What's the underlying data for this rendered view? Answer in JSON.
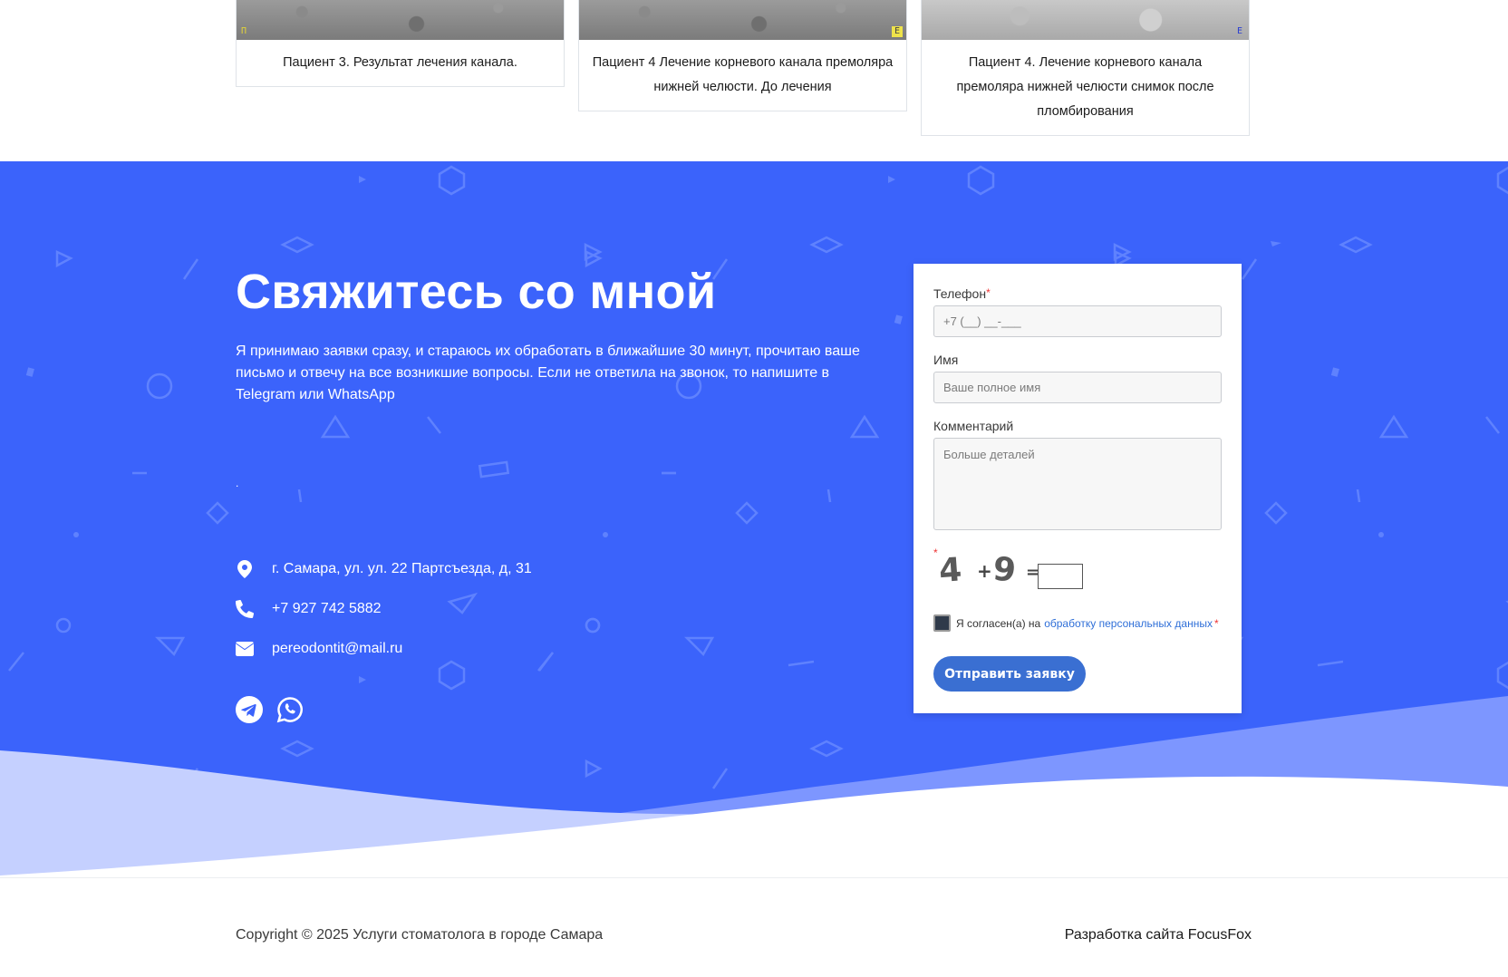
{
  "gallery": {
    "cards": [
      {
        "caption": "Пациент 3. Результат лечения канала."
      },
      {
        "caption": "Пациент 4 Лечение корневого канала премоляра нижней челюсти. До лечения"
      },
      {
        "caption": "Пациент 4. Лечение корневого канала премоляра нижней челюсти снимок после пломбирования"
      }
    ]
  },
  "contact": {
    "title": "Свяжитесь со мной",
    "lead": "Я принимаю заявки сразу, и стараюсь их обработать в ближайшие 30 минут, прочитаю  ваше письмо и отвечу на все возникшие вопросы. Если не ответила на звонок, то напишите в Telegram или WhatsApp",
    "dot": ".",
    "address": "г. Самара, ул. ул. 22 Партсъезда, д, 31",
    "phone": "+7 927 742 5882",
    "email": "pereodontit@mail.ru",
    "icons": {
      "address": "map-marker-icon",
      "phone": "phone-icon",
      "email": "envelope-icon",
      "telegram": "telegram-icon",
      "whatsapp": "whatsapp-icon"
    },
    "colors": {
      "background": "#3b63fb",
      "wave_light": "#7d96ff",
      "wave_lighter": "#c5d0ff"
    }
  },
  "form": {
    "phone_label": "Телефон",
    "phone_placeholder": "+7 (__) __-___",
    "name_label": "Имя",
    "name_placeholder": "Ваше полное имя",
    "comment_label": "Комментарий",
    "comment_placeholder": "Больше деталей",
    "required_mark": "*",
    "captcha": {
      "a": "4",
      "op": "+",
      "b": "9",
      "eq": "="
    },
    "agree_text": "Я согласен(а) на",
    "agree_link": "обработку персональных данных",
    "submit_label": "Отправить заявку",
    "submit_color": "#3a6fd2"
  },
  "footer": {
    "copyright": "Copyright © 2025 Услуги стоматолога в городе Самара",
    "developer": "Разработка сайта FocusFox"
  }
}
